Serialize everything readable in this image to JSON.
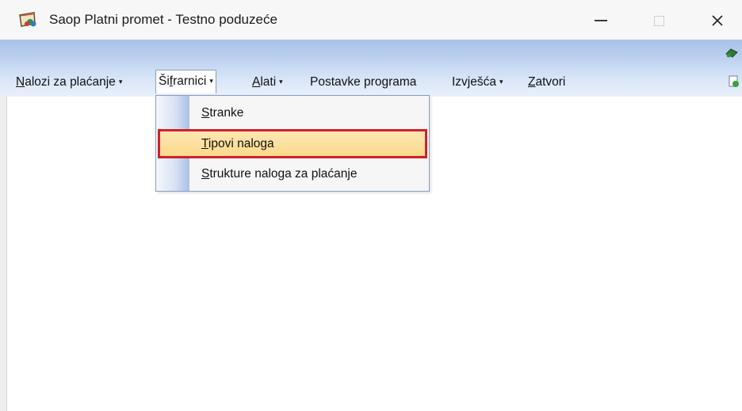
{
  "window": {
    "title": "Saop Platni promet - Testno poduzeće",
    "controls": {
      "minimize": "minimize-icon",
      "maximize": "maximize-icon",
      "close": "close-icon"
    }
  },
  "menu": {
    "items": [
      {
        "first": "N",
        "rest": "alozi za plaćanje",
        "has_arrow": true
      },
      {
        "pre": "Ši",
        "first": "f",
        "rest": "rarnici",
        "has_arrow": true
      },
      {
        "first": "A",
        "rest": "lati",
        "has_arrow": true
      },
      {
        "label": "Postavke programa"
      },
      {
        "label": "Izvješća",
        "has_arrow": true
      },
      {
        "first": "Z",
        "rest": "atvori"
      }
    ],
    "arrow_glyph": "▾"
  },
  "dropdown": {
    "items": [
      {
        "first": "S",
        "rest": "tranke"
      },
      {
        "first": "T",
        "rest": "ipovi naloga",
        "highlighted": true
      },
      {
        "first": "S",
        "rest": "trukture naloga za plaćanje"
      }
    ]
  },
  "colors": {
    "menubar_top": "#a9c2ea",
    "highlight_fill": "#fbd98c",
    "highlight_border": "#d0212d"
  }
}
